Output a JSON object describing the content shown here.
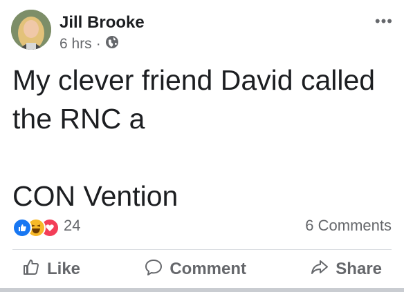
{
  "post": {
    "author": "Jill Brooke",
    "time": "6 hrs",
    "separator": "·",
    "privacy_icon": "globe-icon",
    "more_icon": "more-options-icon",
    "more_label": "•••",
    "text": "My clever friend David called\nthe RNC a\n\nCON Vention"
  },
  "reactions": {
    "types": [
      "like",
      "haha",
      "love"
    ],
    "count": "24",
    "comments": "6 Comments"
  },
  "actions": {
    "like": "Like",
    "comment": "Comment",
    "share": "Share"
  },
  "colors": {
    "like_blue": "#1877f2",
    "haha_yellow": "#f7b928",
    "love_red": "#f33e58",
    "secondary_text": "#65676b"
  }
}
